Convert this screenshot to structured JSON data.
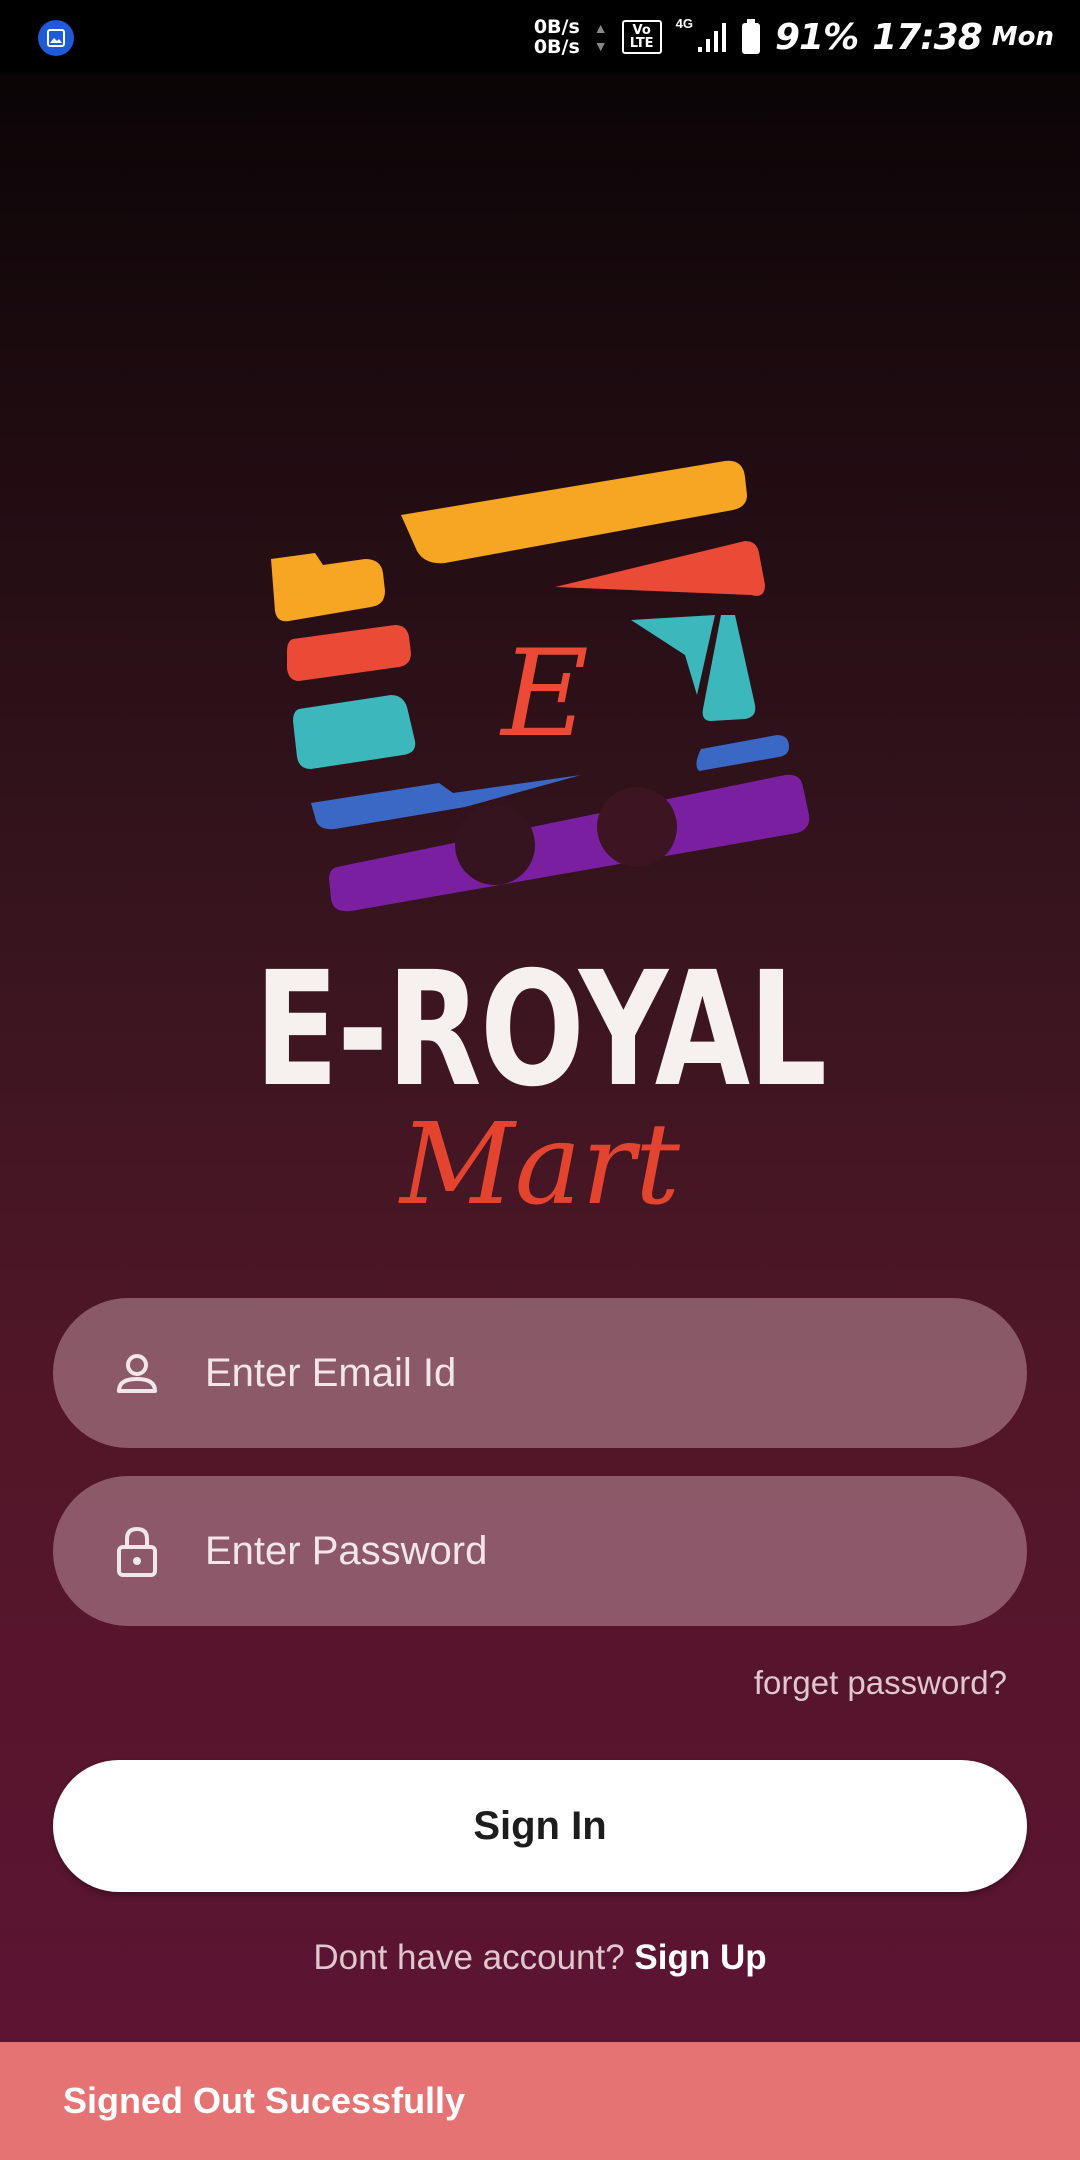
{
  "status_bar": {
    "net_speed_up": "0B/s",
    "net_speed_down": "0B/s",
    "volte": "Vo LTE",
    "network_type": "4G",
    "battery_percent": "91%",
    "time": "17:38",
    "day": "Mon"
  },
  "brand": {
    "logo_letter": "E",
    "name": "E-ROYAL",
    "subtitle": "Mart"
  },
  "form": {
    "email_placeholder": "Enter Email Id",
    "password_placeholder": "Enter Password",
    "forget_password_label": "forget password?",
    "sign_in_label": "Sign In",
    "signup_prompt": "Dont have account?",
    "signup_label": "Sign Up"
  },
  "snackbar": {
    "message": "Signed Out Sucessfully"
  },
  "colors": {
    "accent_red": "#e3442f",
    "snackbar": "#e57373",
    "logo_orange": "#f7a623",
    "logo_red": "#ea4a36",
    "logo_teal": "#3cb8bd",
    "logo_blue": "#3a68c4",
    "logo_purple": "#7a1fa0"
  }
}
